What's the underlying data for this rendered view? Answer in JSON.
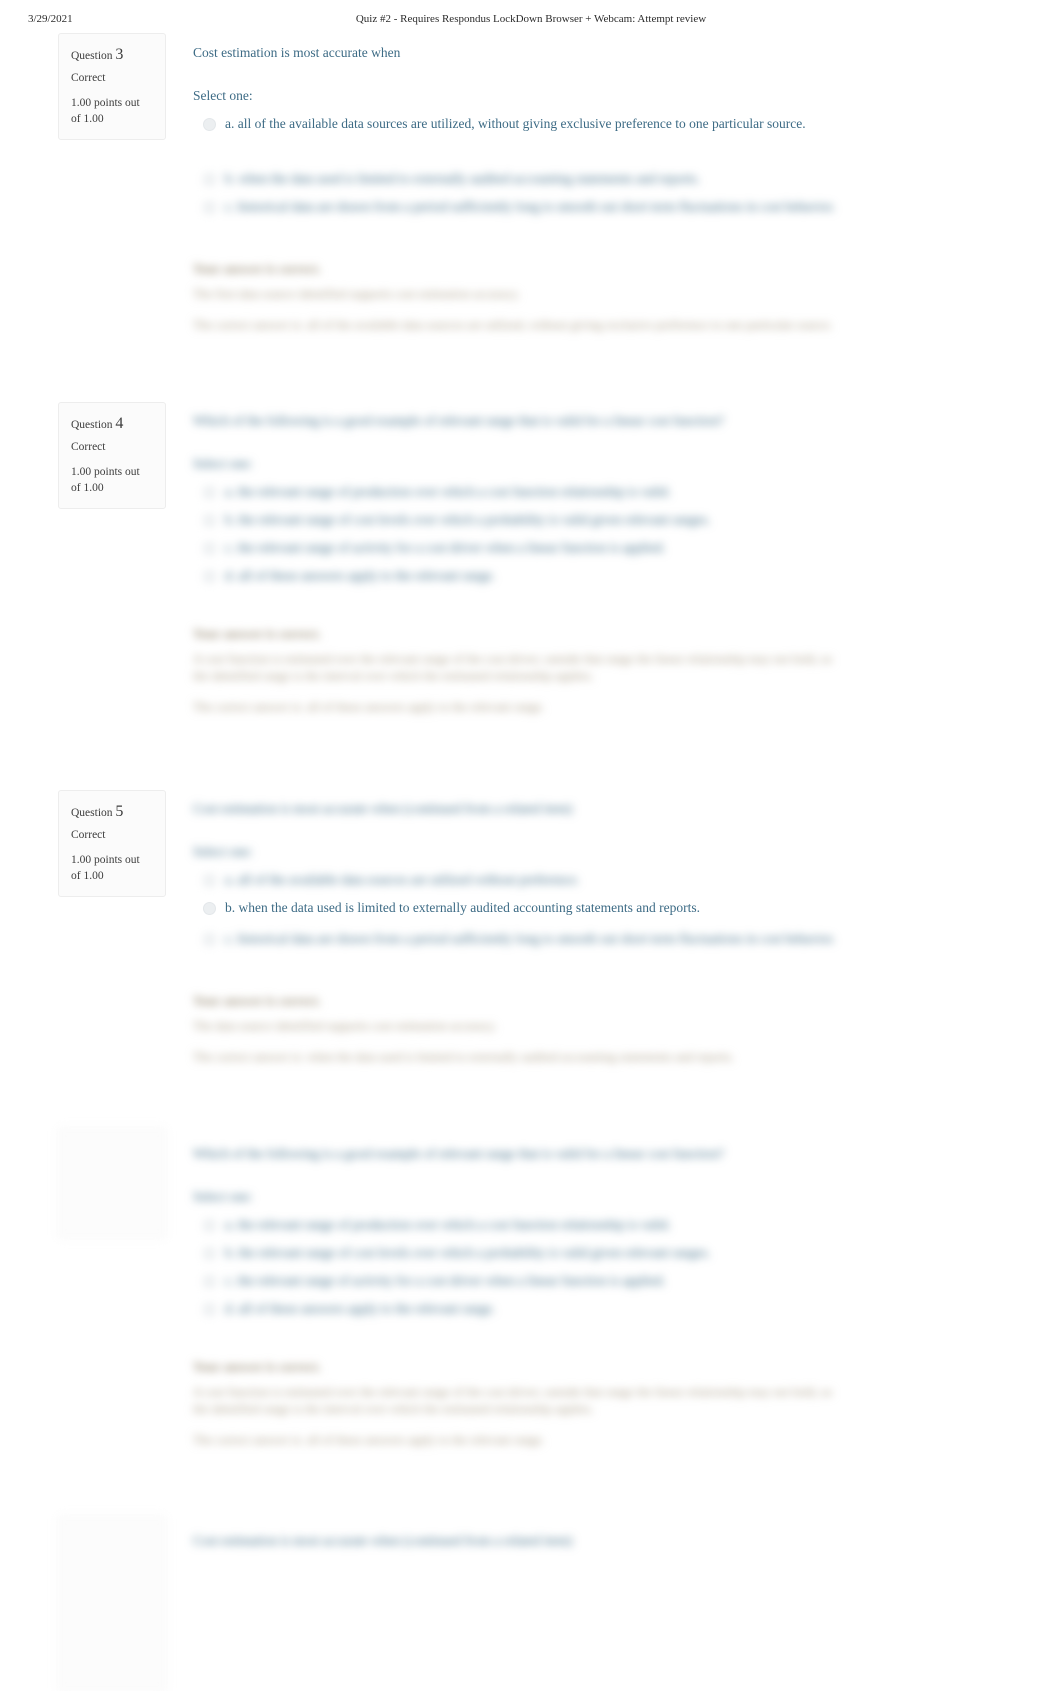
{
  "header": {
    "date": "3/29/2021",
    "doc_title": "Quiz #2 - Requires Respondus LockDown Browser + Webcam: Attempt review"
  },
  "labels": {
    "question_word": "Question",
    "select_one": "Select one:",
    "state_correct": "Correct",
    "points_line1": "1.00 points out",
    "points_line2": "of 1.00",
    "feedback_heading": "Your answer is correct.",
    "answer_prefix": "The correct answer is:"
  },
  "colors": {
    "question_text": "#3d6b85",
    "info_text": "#3c3c3c",
    "feedback_text": "#a89c86",
    "page_background": "#ffffff",
    "box_background": "#fbfbfb"
  },
  "questions": [
    {
      "number": "3",
      "state": "Correct",
      "points": "1.00 points out of 1.00",
      "stem": "Cost estimation is most accurate when",
      "select_one": "Select one:",
      "options": [
        {
          "letter": "a.",
          "text": "all of the available data sources are utilized, without giving exclusive preference to one particular source.",
          "blur": "none"
        },
        {
          "letter": "b.",
          "text": "when the data used is limited to externally audited accounting statements and reports.",
          "blur": "heavy"
        },
        {
          "letter": "c.",
          "text": "historical data are drawn from a period sufficiently long to smooth out short term fluctuations in cost behavior.",
          "blur": "heavy"
        }
      ],
      "feedback_heading": "Your answer is correct.",
      "feedback_body": "The first data source identified supports cost estimation accuracy.",
      "answer_line": "The correct answer is: all of the available data sources are utilized, without giving exclusive preference to one particular source."
    },
    {
      "number": "4",
      "state": "Correct",
      "points": "1.00 points out of 1.00",
      "stem": "Which of the following is a good example of relevant range that is valid for a linear cost function?",
      "select_one": "Select one:",
      "options": [
        {
          "letter": "a.",
          "text": "the relevant range of production over which a cost function relationship is valid.",
          "blur": "heavy"
        },
        {
          "letter": "b.",
          "text": "the relevant range of cost levels over which a probability is valid given relevant ranges.",
          "blur": "heavy"
        },
        {
          "letter": "c.",
          "text": "the relevant range of activity for a cost driver when a linear function is applied.",
          "blur": "heavy"
        },
        {
          "letter": "d.",
          "text": "all of these answers apply to the relevant range.",
          "blur": "heavy"
        }
      ],
      "feedback_heading": "Your answer is correct.",
      "feedback_body": "A cost function is estimated over the relevant range of the cost driver; outside that range the linear relationship may not hold, so the identified range is the interval over which the estimated relationship applies.",
      "answer_line": "The correct answer is: all of these answers apply to the relevant range."
    },
    {
      "number": "5",
      "state": "Correct",
      "points": "1.00 points out of 1.00",
      "stem": "Cost estimation is most accurate when (continued from a related item)",
      "select_one": "Select one:",
      "options": [
        {
          "letter": "a.",
          "text": "all of the available data sources are utilized without preference.",
          "blur": "heavy"
        },
        {
          "letter": "b.",
          "text": "when the data used is limited to externally audited accounting statements and reports.",
          "blur": "none"
        },
        {
          "letter": "c.",
          "text": "historical data are drawn from a period sufficiently long to smooth out short term fluctuations in cost behavior.",
          "blur": "heavy"
        }
      ],
      "feedback_heading": "Your answer is correct.",
      "feedback_body": "The data source identified supports cost estimation accuracy.",
      "answer_line": "The correct answer is: when the data used is limited to externally audited accounting statements and reports."
    },
    {
      "number": "",
      "state": "",
      "points": "",
      "stem": "Which of the following is a good example of relevant range that is valid for a linear cost function?",
      "select_one": "Select one:",
      "options": [
        {
          "letter": "a.",
          "text": "the relevant range of production over which a cost function relationship is valid.",
          "blur": "heavy"
        },
        {
          "letter": "b.",
          "text": "the relevant range of cost levels over which a probability is valid given relevant ranges.",
          "blur": "heavy"
        },
        {
          "letter": "c.",
          "text": "the relevant range of activity for a cost driver when a linear function is applied.",
          "blur": "heavy"
        },
        {
          "letter": "d.",
          "text": "all of these answers apply to the relevant range.",
          "blur": "heavy"
        }
      ],
      "feedback_heading": "Your answer is correct.",
      "feedback_body": "A cost function is estimated over the relevant range of the cost driver; outside that range the linear relationship may not hold, so the identified range is the interval over which the estimated relationship applies.",
      "answer_line": "The correct answer is: all of these answers apply to the relevant range."
    },
    {
      "number": "",
      "state": "",
      "points": "",
      "stem": "Cost estimation is most accurate when (continued from a related item)",
      "select_one": "",
      "options": [],
      "feedback_heading": "",
      "feedback_body": "",
      "answer_line": ""
    }
  ]
}
